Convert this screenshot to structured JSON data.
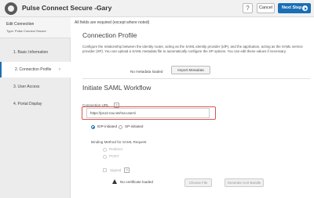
{
  "header": {
    "title": "Pulse Connect Secure -Gary",
    "help_label": "?",
    "cancel_label": "Cancel",
    "next_label": "Next Step"
  },
  "sidebar": {
    "head_title": "Edit Connection",
    "head_type": "Type: Pulse Connect Secure",
    "items": [
      {
        "label": "1. Basic Information"
      },
      {
        "label": "2. Connection Profile",
        "active": true,
        "chevron": "›"
      },
      {
        "label": "3. User Access"
      },
      {
        "label": "4. Portal Display"
      }
    ]
  },
  "main": {
    "required_note": "All fields are required (except where noted)",
    "profile_title": "Connection Profile",
    "profile_desc": "Configure the relationship between the identity router, acting as the SAML identity provider (IdP), and the application, acting as the SAML service provider (SP). You can upload a SAML metadata file to automatically configure the SP options. You can edit these values if necessary.",
    "metadata_status": "No metadata loaded",
    "import_button": "Import Metadata",
    "saml_title": "Initiate SAML Workflow",
    "connection_url_label": "Connection URL",
    "connection_url_help": "?",
    "connection_url_value": "https://ps13.rsa.net/rsa-users/",
    "initiation_options": [
      {
        "label": "IDP-initiated",
        "checked": true
      },
      {
        "label": "SP-initiated",
        "checked": false
      }
    ],
    "binding_label": "Binding Method for SAML Request",
    "binding_options": [
      {
        "label": "Redirect"
      },
      {
        "label": "POST"
      }
    ],
    "signed_label": "Signed",
    "signed_help": "?",
    "certificate_status": "No certificate loaded",
    "choose_file_button": "Choose File",
    "generate_cert_button": "Generate Cert Bundle"
  },
  "colors": {
    "accent": "#1a6fb5",
    "highlight": "#d9534f"
  }
}
